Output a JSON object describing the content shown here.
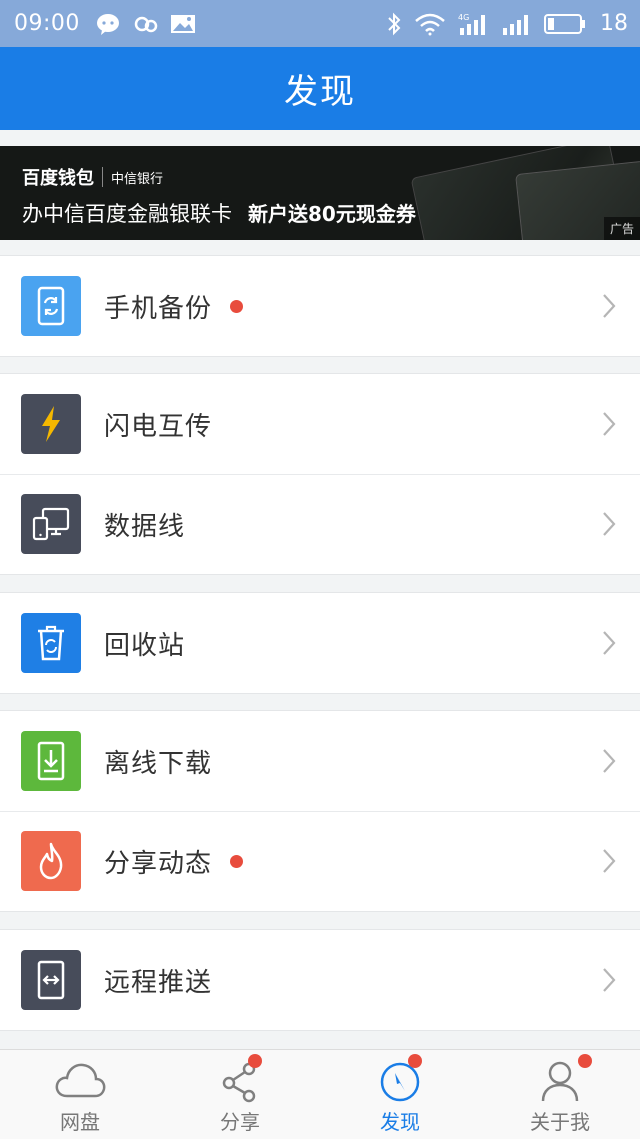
{
  "status_bar": {
    "time": "09:00",
    "battery": "18",
    "icons": [
      "wechat-icon",
      "link-icon",
      "image-icon",
      "bluetooth-icon",
      "wifi-icon",
      "signal-4g-icon",
      "signal-icon",
      "battery-icon"
    ]
  },
  "header": {
    "title": "发现"
  },
  "banner": {
    "brand": "百度钱包",
    "bank": "中信银行",
    "text": "办中信百度金融银联卡",
    "promo": "新户送80元现金券",
    "ad_label": "广告"
  },
  "menu": {
    "backup": {
      "label": "手机备份",
      "icon": "phone-sync-icon",
      "color": "#4aa3f0"
    },
    "flash": {
      "label": "闪电互传",
      "icon": "lightning-icon",
      "color": "#474c5a"
    },
    "cable": {
      "label": "数据线",
      "icon": "devices-icon",
      "color": "#474c5a"
    },
    "recycle": {
      "label": "回收站",
      "icon": "trash-icon",
      "color": "#1f7fe5"
    },
    "offline": {
      "label": "离线下载",
      "icon": "download-icon",
      "color": "#5db83c"
    },
    "share_feed": {
      "label": "分享动态",
      "icon": "flame-icon",
      "color": "#ef6a4e"
    },
    "remote": {
      "label": "远程推送",
      "icon": "remote-push-icon",
      "color": "#474c5a"
    }
  },
  "tabs": [
    {
      "label": "网盘",
      "icon": "cloud-icon"
    },
    {
      "label": "分享",
      "icon": "share-icon"
    },
    {
      "label": "发现",
      "icon": "compass-icon"
    },
    {
      "label": "关于我",
      "icon": "person-icon"
    }
  ],
  "colors": {
    "accent": "#1a7de6",
    "status_bar": "#86a9d9",
    "badge": "#e84c3d"
  }
}
